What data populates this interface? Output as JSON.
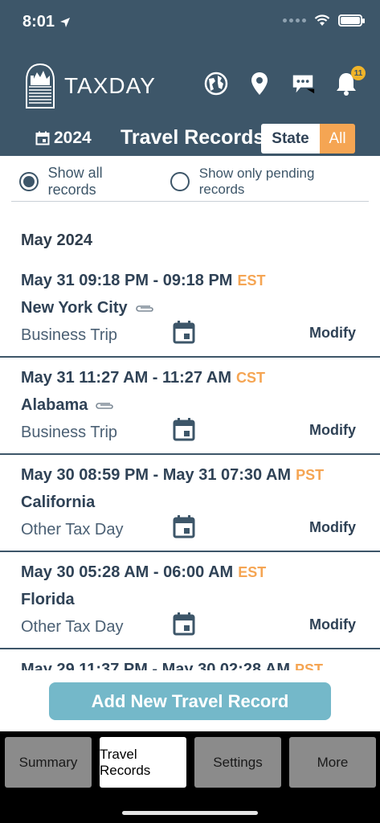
{
  "status_bar": {
    "time": "8:01"
  },
  "brand": {
    "name": "TAXDAY",
    "notification_count": "11"
  },
  "subbar": {
    "year": "2024",
    "title": "Travel Records",
    "segment_state": "State",
    "segment_all": "All"
  },
  "filters": {
    "option_all": "Show all records",
    "option_pending": "Show only pending records",
    "selected": "all"
  },
  "month_header": "May 2024",
  "records": [
    {
      "time": "May 31 09:18 PM - 09:18 PM",
      "tz": "EST",
      "place": "New York City",
      "attachment": true,
      "type": "Business Trip",
      "action": "Modify"
    },
    {
      "time": "May 31 11:27 AM - 11:27 AM",
      "tz": "CST",
      "place": "Alabama",
      "attachment": true,
      "type": "Business Trip",
      "action": "Modify"
    },
    {
      "time": "May 30 08:59 PM - May 31 07:30 AM",
      "tz": "PST",
      "place": "California",
      "attachment": false,
      "type": "Other Tax Day",
      "action": "Modify"
    },
    {
      "time": "May 30 05:28 AM - 06:00 AM",
      "tz": "EST",
      "place": "Florida",
      "attachment": false,
      "type": "Other Tax Day",
      "action": "Modify"
    },
    {
      "time": "May 29 11:37 PM - May 30 02:28 AM",
      "tz": "PST",
      "place": "",
      "attachment": false,
      "type": "",
      "action": ""
    }
  ],
  "add_button": "Add New Travel Record",
  "tabs": [
    {
      "label": "Summary",
      "active": false
    },
    {
      "label": "Travel Records",
      "active": true
    },
    {
      "label": "Settings",
      "active": false
    },
    {
      "label": "More",
      "active": false
    }
  ],
  "colors": {
    "header_bg": "#3d5669",
    "accent_orange": "#f5a553",
    "add_button": "#74b8c9",
    "badge": "#f0b429"
  },
  "icons": [
    "location-arrow-icon",
    "wifi-icon",
    "battery-icon",
    "taxday-logo-icon",
    "globe-icon",
    "location-pin-icon",
    "chat-icon",
    "bell-icon",
    "calendar-icon",
    "paperclip-icon"
  ]
}
